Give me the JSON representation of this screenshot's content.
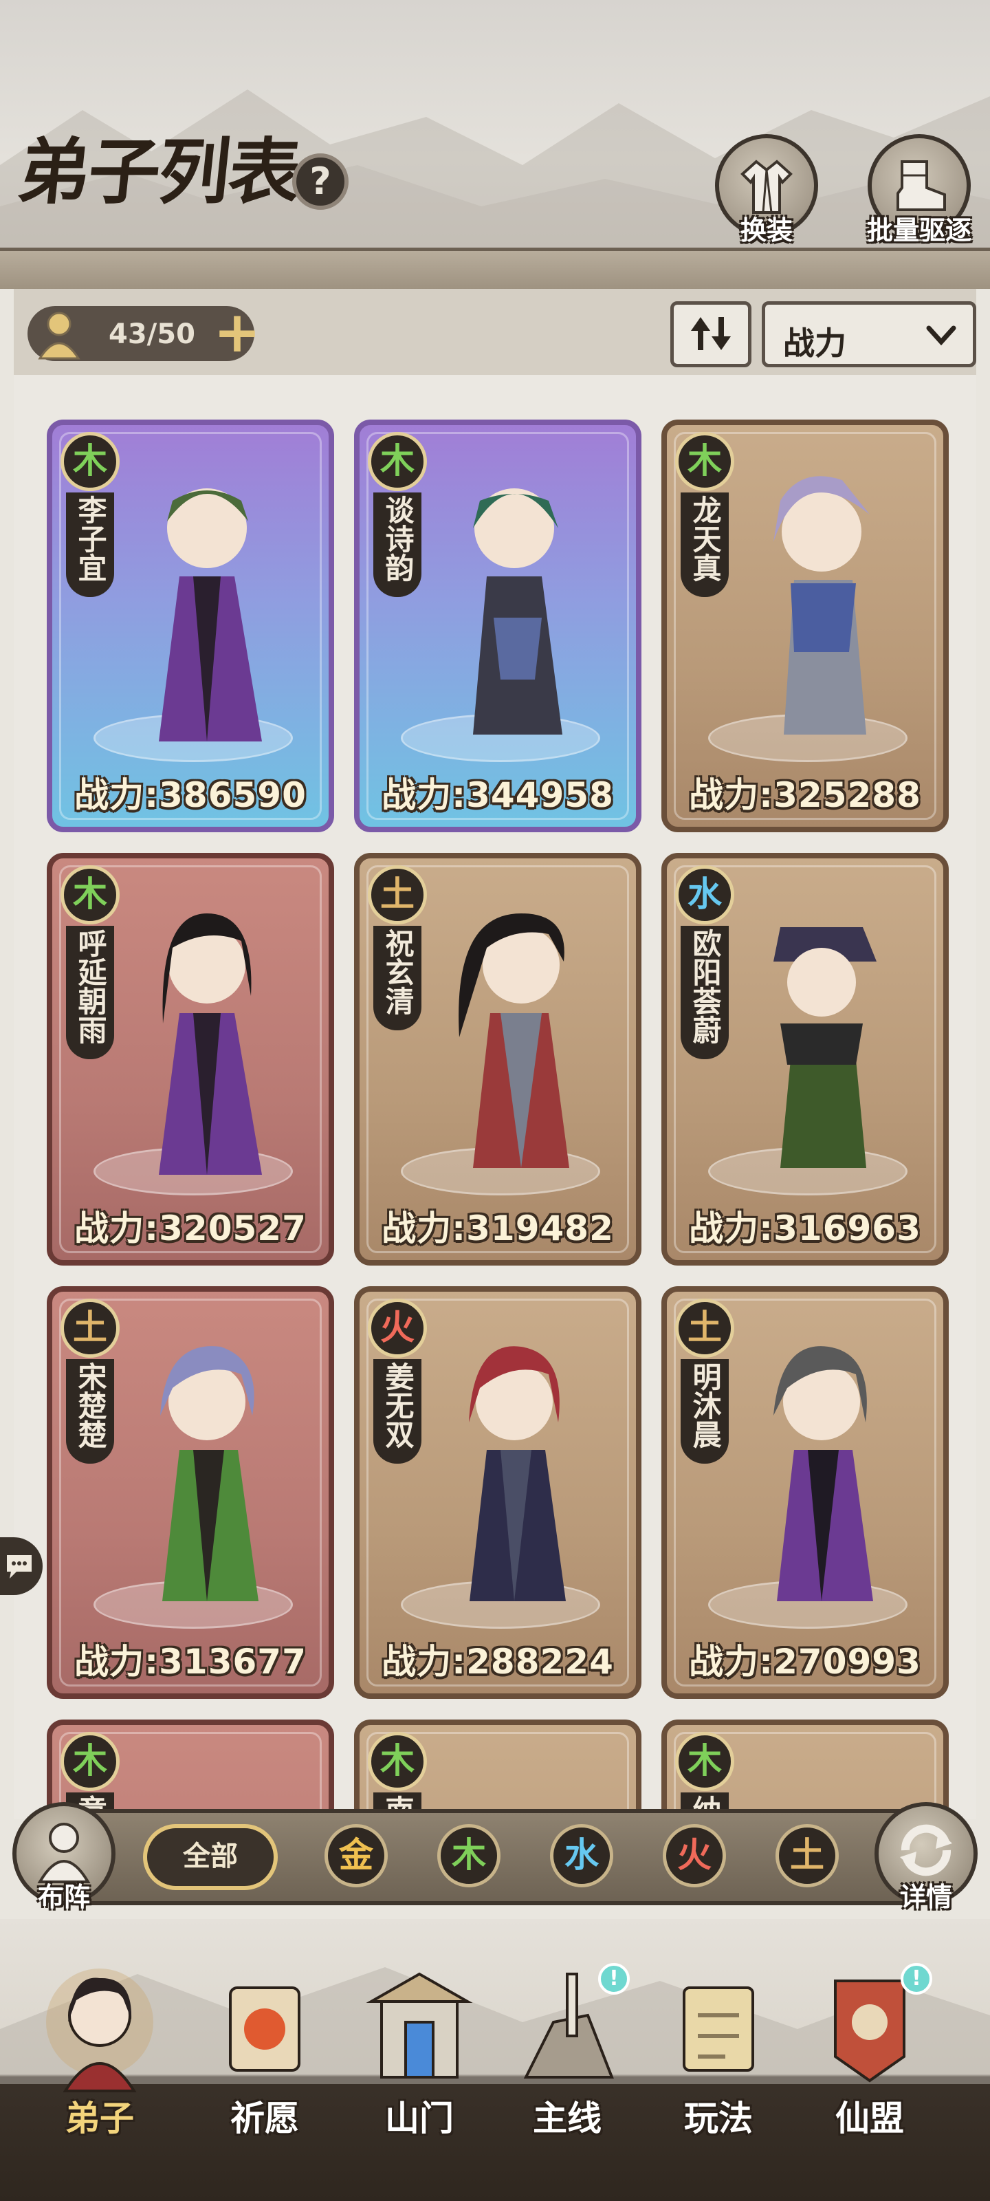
{
  "header": {
    "title": "弟子列表",
    "help_label": "?",
    "change_outfit_label": "换装",
    "batch_dismiss_label": "批量驱逐"
  },
  "controls": {
    "disciple_count": "43/50",
    "sort_value": "战力"
  },
  "cards": [
    {
      "element": "木",
      "name": "李子宜",
      "power": "战力:386590"
    },
    {
      "element": "木",
      "name": "谈诗韵",
      "power": "战力:344958"
    },
    {
      "element": "木",
      "name": "龙天真",
      "power": "战力:325288"
    },
    {
      "element": "木",
      "name": "呼延朝雨",
      "power": "战力:320527"
    },
    {
      "element": "土",
      "name": "祝玄清",
      "power": "战力:319482"
    },
    {
      "element": "水",
      "name": "欧阳荟蔚",
      "power": "战力:316963"
    },
    {
      "element": "土",
      "name": "宋楚楚",
      "power": "战力:313677"
    },
    {
      "element": "火",
      "name": "姜无双",
      "power": "战力:288224"
    },
    {
      "element": "土",
      "name": "明沐晨",
      "power": "战力:270993"
    },
    {
      "element": "木",
      "name": "章"
    },
    {
      "element": "木",
      "name": "南"
    },
    {
      "element": "木",
      "name": "纳"
    }
  ],
  "filter": {
    "formation_label": "布阵",
    "all_label": "全部",
    "elements": [
      "金",
      "木",
      "水",
      "火",
      "土"
    ],
    "detail_label": "详情"
  },
  "nav": {
    "items": [
      "弟子",
      "祈愿",
      "山门",
      "主线",
      "玩法",
      "仙盟"
    ],
    "badge": "!"
  },
  "colors": {
    "wood": "#7fd05a",
    "earth": "#e0b56a",
    "water": "#66c8f0",
    "fire": "#f06a5a",
    "gold": "#f0c050",
    "accent_gold": "#e3c57a"
  }
}
